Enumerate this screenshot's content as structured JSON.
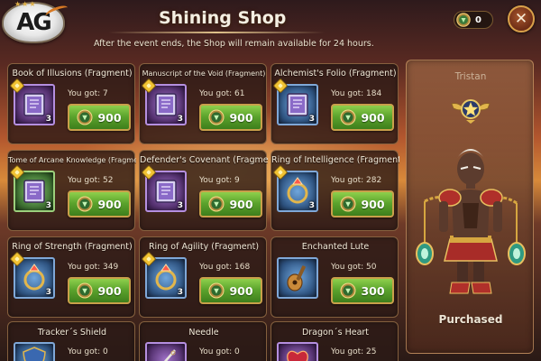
{
  "header": {
    "logo_text": "AG",
    "title": "Shining Shop",
    "subtitle": "After the event ends, the Shop will remain available for 24 hours.",
    "currency_amount": "0",
    "currency_icon": "emerald-coin-icon",
    "close_icon": "close-icon",
    "close_glyph": "✕"
  },
  "items": [
    {
      "name": "Book of Illusions (Fragment)",
      "owned": "You got: 7",
      "price": "900",
      "count": "3",
      "icon": "book-icon",
      "fragment": true
    },
    {
      "name": "Manuscript of the Void (Fragment)",
      "owned": "You got: 61",
      "price": "900",
      "count": "3",
      "icon": "book-icon",
      "fragment": true
    },
    {
      "name": "Alchemist's Folio (Fragment)",
      "owned": "You got: 184",
      "price": "900",
      "count": "3",
      "icon": "book-icon",
      "fragment": true
    },
    {
      "name": "Tome of Arcane Knowledge (Fragment)",
      "owned": "You got: 52",
      "price": "900",
      "count": "3",
      "icon": "book-icon",
      "fragment": true
    },
    {
      "name": "Defender's Covenant (Fragment)",
      "owned": "You got: 9",
      "price": "900",
      "count": "3",
      "icon": "book-icon",
      "fragment": true
    },
    {
      "name": "Ring of Intelligence (Fragment)",
      "owned": "You got: 282",
      "price": "900",
      "count": "3",
      "icon": "ring-icon",
      "fragment": true
    },
    {
      "name": "Ring of Strength (Fragment)",
      "owned": "You got: 349",
      "price": "900",
      "count": "3",
      "icon": "ring-icon",
      "fragment": true
    },
    {
      "name": "Ring of Agility (Fragment)",
      "owned": "You got: 168",
      "price": "900",
      "count": "3",
      "icon": "ring-icon",
      "fragment": true
    },
    {
      "name": "Enchanted Lute",
      "owned": "You got: 50",
      "price": "300",
      "count": "",
      "icon": "lute-icon",
      "fragment": false
    },
    {
      "name": "Tracker´s Shield",
      "owned": "You got: 0",
      "price": "",
      "count": "",
      "icon": "shield-icon",
      "fragment": false
    },
    {
      "name": "Needle",
      "owned": "You got: 0",
      "price": "",
      "count": "",
      "icon": "needle-icon",
      "fragment": false
    },
    {
      "name": "Dragon´s Heart",
      "owned": "You got: 25",
      "price": "",
      "count": "",
      "icon": "heart-icon",
      "fragment": false
    }
  ],
  "hero": {
    "name": "Tristan",
    "status": "Purchased",
    "emblem_icon": "winged-star-emblem-icon",
    "portrait": "hero-portrait"
  },
  "colors": {
    "buy_button": "#5aa22c",
    "card_border": "#b08848",
    "panel_bg": "#2c1a16"
  }
}
